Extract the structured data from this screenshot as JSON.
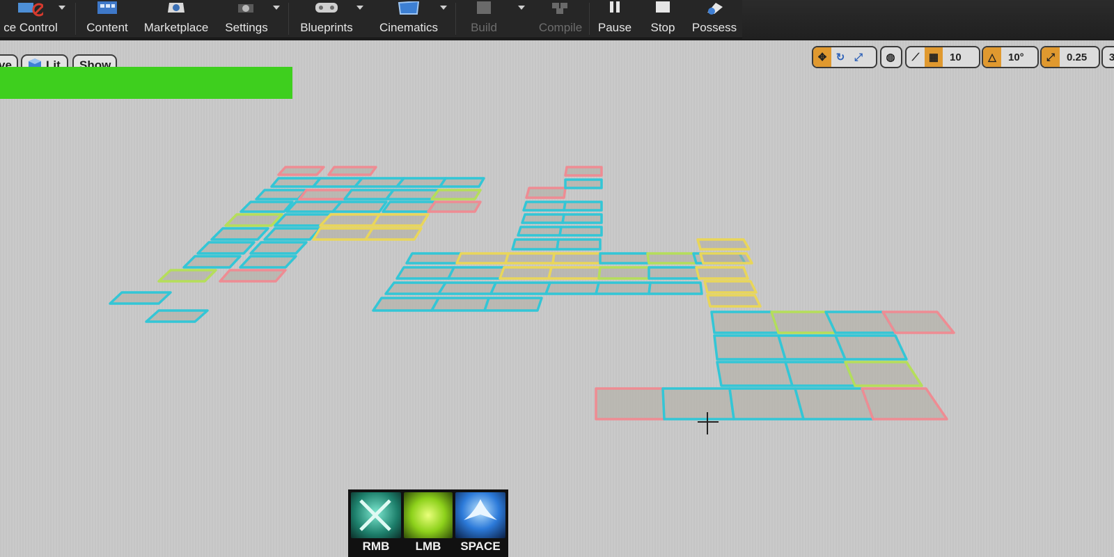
{
  "toolbar": {
    "source_control_label": "ce Control",
    "content_label": "Content",
    "marketplace_label": "Marketplace",
    "settings_label": "Settings",
    "blueprints_label": "Blueprints",
    "cinematics_label": "Cinematics",
    "build_label": "Build",
    "compile_label": "Compile",
    "pause_label": "Pause",
    "stop_label": "Stop",
    "possess_label": "Possess"
  },
  "viewport": {
    "perspective_label": "ve",
    "lit_label": "Lit",
    "show_label": "Show",
    "grid_snap_value": "10",
    "rotation_snap_value": "10°",
    "scale_snap_value": "0.25",
    "overflow_label": "3"
  },
  "action_bar": {
    "skills": [
      {
        "key": "RMB",
        "icon": "crossed-swords-icon",
        "color": "#2fb79a"
      },
      {
        "key": "LMB",
        "icon": "burst-icon",
        "color": "#8bd11b"
      },
      {
        "key": "SPACE",
        "icon": "wing-dash-icon",
        "color": "#2c7ad9"
      }
    ]
  },
  "colors": {
    "tile_cyan": "#33c6d6",
    "tile_yellow": "#e9d65a",
    "tile_green": "#b5de5a",
    "tile_pink": "#ee8c93",
    "tile_fill": "#aeaca0"
  }
}
